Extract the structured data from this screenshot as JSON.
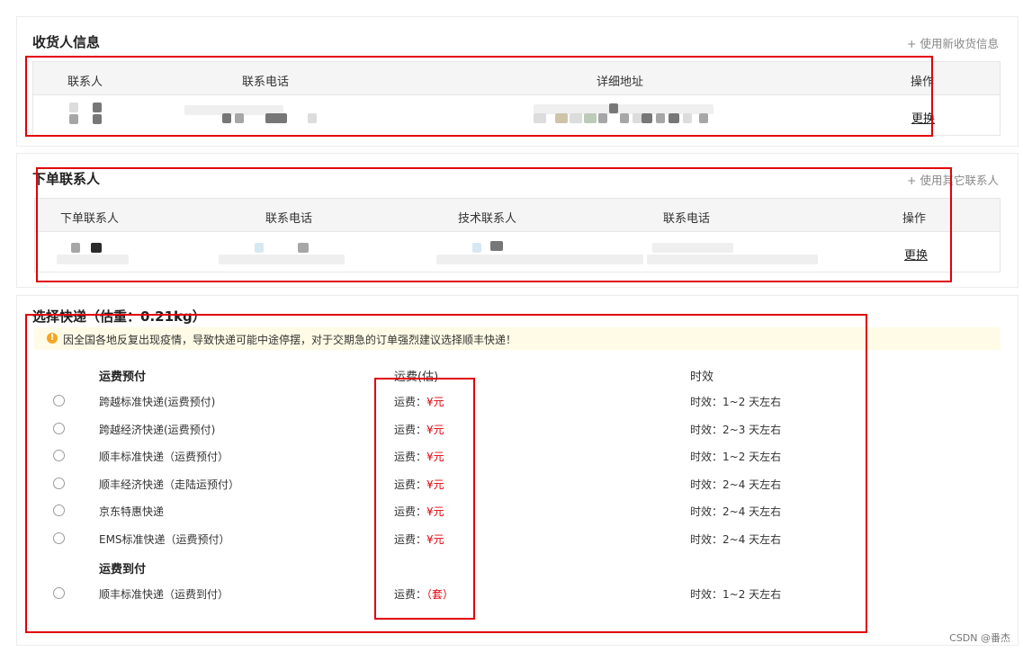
{
  "receiver": {
    "title": "收货人信息",
    "action_link": "+ 使用新收货信息",
    "columns": [
      "联系人",
      "联系电话",
      "详细地址",
      "操作"
    ],
    "row": {
      "action": "更换"
    }
  },
  "order_contact": {
    "title": "下单联系人",
    "action_link": "+ 使用其它联系人",
    "columns": [
      "下单联系人",
      "联系电话",
      "技术联系人",
      "联系电话",
      "操作"
    ],
    "row": {
      "action": "更换"
    }
  },
  "shipping": {
    "title": "选择快递（估重：0.21kg）",
    "notice": "因全国各地反复出现疫情，导致快递可能中途停摆，对于交期急的订单强烈建议选择顺丰快递！",
    "columns": {
      "group": "运费预付",
      "fee": "运费(估)",
      "eta": "时效"
    },
    "prepaid_label": "运费预付",
    "prepaid": [
      {
        "name": "跨越标准快递(运费预付)",
        "fee_label": "运费：",
        "fee_value": "¥元",
        "eta": "时效：1~2 天左右"
      },
      {
        "name": "跨越经济快递(运费预付)",
        "fee_label": "运费：",
        "fee_value": "¥元",
        "eta": "时效：2~3 天左右"
      },
      {
        "name": "顺丰标准快递（运费预付）",
        "fee_label": "运费：",
        "fee_value": "¥元",
        "eta": "时效：1~2 天左右"
      },
      {
        "name": "顺丰经济快递（走陆运预付）",
        "fee_label": "运费：",
        "fee_value": "¥元",
        "eta": "时效：2~4 天左右"
      },
      {
        "name": "京东特惠快递",
        "fee_label": "运费：",
        "fee_value": "¥元",
        "eta": "时效：2~4 天左右"
      },
      {
        "name": "EMS标准快递（运费预付）",
        "fee_label": "运费：",
        "fee_value": "¥元",
        "eta": "时效：2~4 天左右"
      }
    ],
    "collect_label": "运费到付",
    "collect": [
      {
        "name": "顺丰标准快递（运费到付）",
        "fee_label": "运费：",
        "fee_value": "（套）",
        "eta": "时效：1~2 天左右"
      }
    ]
  },
  "watermark": "CSDN @番杰",
  "colors": {
    "highlight_border": "#e0000a",
    "price": "#e0000a",
    "notice_bg": "#fffbe6",
    "notice_icon": "#f5a623"
  }
}
